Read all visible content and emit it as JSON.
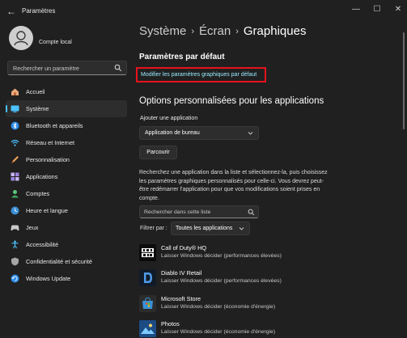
{
  "window": {
    "title": "Paramètres",
    "back_glyph": "←",
    "minimize_glyph": "—",
    "maximize_glyph": "☐",
    "close_glyph": "✕"
  },
  "account": {
    "label": "Compte local"
  },
  "search": {
    "placeholder": "Rechercher un paramètre"
  },
  "sidebar": {
    "items": [
      {
        "label": "Accueil",
        "icon": "home-icon"
      },
      {
        "label": "Système",
        "icon": "system-icon",
        "selected": true
      },
      {
        "label": "Bluetooth et appareils",
        "icon": "bluetooth-icon"
      },
      {
        "label": "Réseau et Internet",
        "icon": "network-icon"
      },
      {
        "label": "Personnalisation",
        "icon": "personalization-icon"
      },
      {
        "label": "Applications",
        "icon": "apps-icon"
      },
      {
        "label": "Comptes",
        "icon": "accounts-icon"
      },
      {
        "label": "Heure et langue",
        "icon": "time-language-icon"
      },
      {
        "label": "Jeux",
        "icon": "gaming-icon"
      },
      {
        "label": "Accessibilité",
        "icon": "accessibility-icon"
      },
      {
        "label": "Confidentialité et sécurité",
        "icon": "privacy-shield-icon"
      },
      {
        "label": "Windows Update",
        "icon": "windows-update-icon"
      }
    ]
  },
  "breadcrumb": {
    "item1": "Système",
    "item2": "Écran",
    "current": "Graphiques",
    "separator": "›"
  },
  "defaults": {
    "heading": "Paramètres par défaut",
    "link": "Modifier les paramètres graphiques par défaut"
  },
  "custom": {
    "heading": "Options personnalisées pour les applications",
    "add_label": "Ajouter une application",
    "app_type_selected": "Application de bureau",
    "browse_button": "Parcourir",
    "description": "Recherchez une application dans la liste et sélectionnez-la, puis choisissez les paramètres graphiques personnalisés pour celle-ci. Vous devrez peut-être redémarrer l'application pour que vos modifications soient prises en compte.",
    "search_placeholder": "Rechercher dans cette liste",
    "filter_label": "Filtrer par :",
    "filter_selected": "Toutes les applications"
  },
  "apps": [
    {
      "name": "Call of Duty® HQ",
      "status": "Laisser Windows décider (performances élevées)",
      "icon": "call-of-duty-icon"
    },
    {
      "name": "Diablo IV Retail",
      "status": "Laisser Windows décider (performances élevées)",
      "icon": "diablo-icon"
    },
    {
      "name": "Microsoft Store",
      "status": "Laisser Windows décider (économie d'énergie)",
      "icon": "microsoft-store-icon"
    },
    {
      "name": "Photos",
      "status": "Laisser Windows décider (économie d'énergie)",
      "icon": "photos-icon"
    }
  ],
  "colors": {
    "background": "#202020",
    "accent": "#4cc2ff",
    "link": "#99ebff",
    "highlight_box": "#e8121c"
  }
}
